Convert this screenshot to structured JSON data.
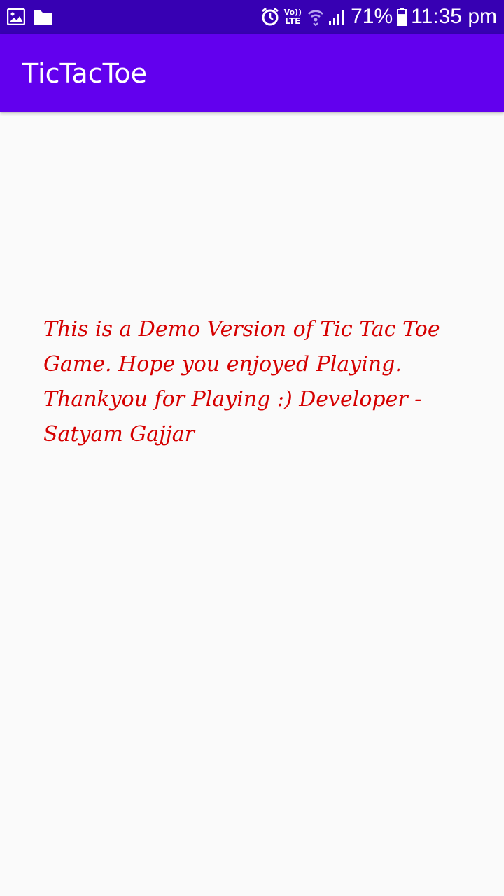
{
  "status_bar": {
    "left_icons": [
      "gallery-icon",
      "folder-icon"
    ],
    "right_icons": [
      "alarm-icon",
      "volte-lte-icon",
      "wifi-icon",
      "signal-icon",
      "battery-icon"
    ],
    "volte_label": "Vo))",
    "lte_label": "LTE",
    "battery_percent": "71%",
    "battery_level": 0.71,
    "time": "11:35 pm",
    "background_color": "#3700b3"
  },
  "app_bar": {
    "title": "TicTacToe",
    "background_color": "#6200ee"
  },
  "main": {
    "message": "This is a Demo Version of Tic Tac Toe Game. Hope you enjoyed Playing. Thankyou for Playing :) Developer - Satyam Gajjar",
    "message_color": "#d50000"
  }
}
